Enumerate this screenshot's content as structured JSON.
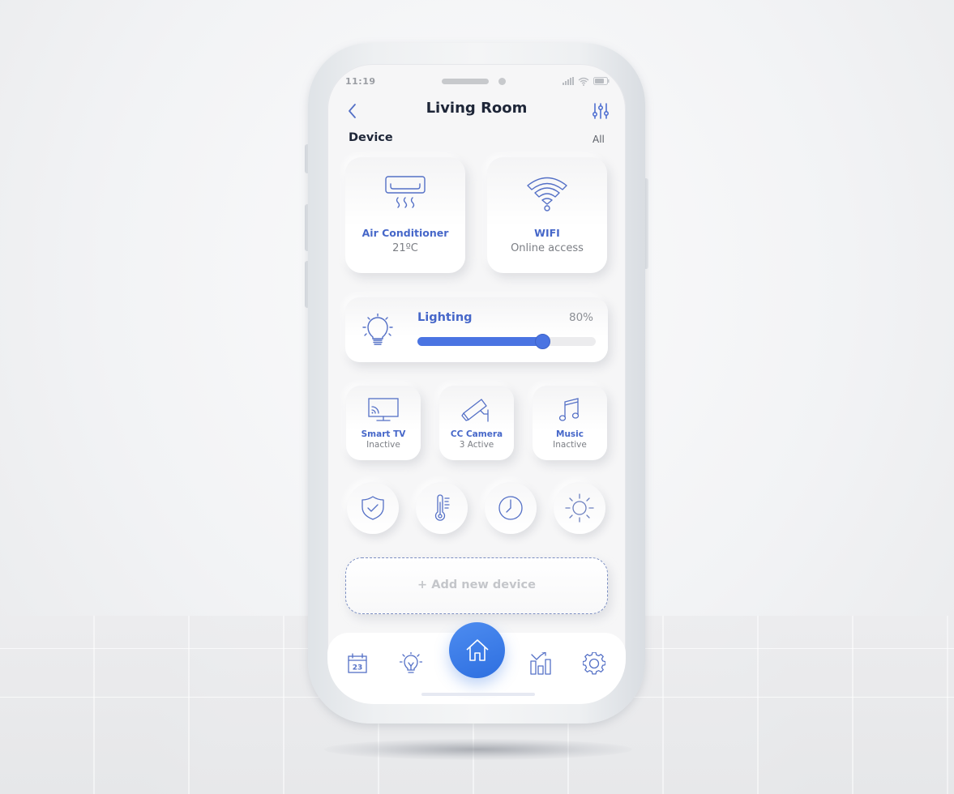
{
  "status_bar": {
    "time": "11:19",
    "icons": [
      "signal-icon",
      "wifi-icon",
      "battery-icon"
    ]
  },
  "header": {
    "title": "Living Room",
    "back_icon": "chevron-left-icon",
    "filter_icon": "sliders-icon"
  },
  "section": {
    "title": "Device",
    "all_label": "All"
  },
  "devices_large": [
    {
      "label": "Air Conditioner",
      "sub": "21ºC",
      "icon": "air-conditioner-icon"
    },
    {
      "label": "WIFI",
      "sub": "Online access",
      "icon": "wifi-icon"
    }
  ],
  "lighting": {
    "label": "Lighting",
    "value_label": "80%",
    "value": 0.7,
    "icon": "lightbulb-icon"
  },
  "devices_small": [
    {
      "label": "Smart TV",
      "sub": "Inactive",
      "icon": "smart-tv-icon"
    },
    {
      "label": "CC Camera",
      "sub": "3 Active",
      "icon": "cctv-camera-icon"
    },
    {
      "label": "Music",
      "sub": "Inactive",
      "icon": "music-note-icon"
    }
  ],
  "quick_actions": [
    "shield-check-icon",
    "thermometer-icon",
    "clock-icon",
    "sun-icon"
  ],
  "add_device": {
    "label": "+ Add new device"
  },
  "bottom_nav": {
    "items": [
      {
        "icon": "calendar-icon",
        "text": "23"
      },
      {
        "icon": "lightbulb-icon"
      },
      {
        "icon": "home-icon",
        "active": true
      },
      {
        "icon": "bar-chart-icon"
      },
      {
        "icon": "gear-icon"
      }
    ]
  },
  "colors": {
    "accent": "#4a74e2",
    "home_button": "#3b7ce8",
    "title_text": "#1e2638",
    "label_blue": "#4667c9",
    "muted_text": "#7b7e84"
  }
}
